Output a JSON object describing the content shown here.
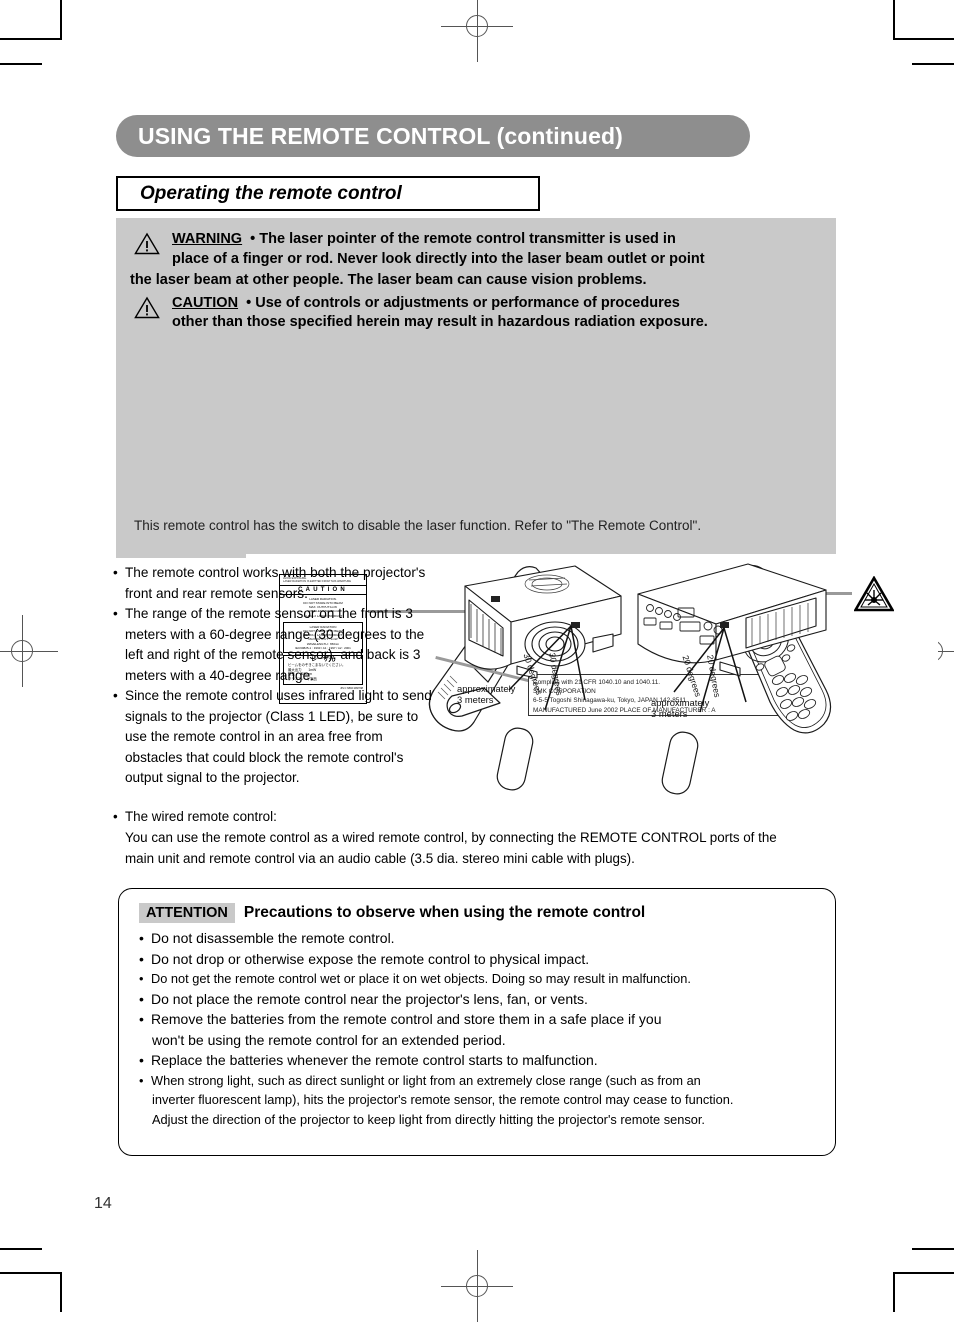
{
  "header": {
    "banner_title": "USING THE REMOTE CONTROL (continued)",
    "subsection_title": "Operating the remote control"
  },
  "warning_panel": {
    "warning_label": "WARNING",
    "warning_text": "• The laser pointer of the remote control transmitter is used in place of a finger or rod. Never look directly into the laser beam outlet or point the laser beam at other people. The laser beam can cause vision problems.",
    "warning_line1": "WARNING",
    "warning_line1_rest": "• The laser pointer of the remote control transmitter is used in",
    "warning_line2": "place of a finger or rod. Never look directly into the laser beam outlet or point",
    "warning_line3": "the laser beam at other people. The laser beam can cause vision problems.",
    "caution_label": "CAUTION",
    "caution_line1_rest": "• Use of controls or adjustments or performance of procedures",
    "caution_line2": "other than those specified herein may result in hazardous radiation exposure.",
    "caution_text": "• Use of controls or adjustments or performance of procedures other than those specified herein may result in hazardous radiation exposure.",
    "illustration_caption": "This remote control has the switch to disable the laser function. Refer to \"The Remote Control\".",
    "laser_label": {
      "top_line1": "AVOID EXPOSURE.",
      "top_line2": "LASER RADIATION IS EMITTED FROM THIS APERTURE",
      "caution_word": "CAUTION",
      "body_line1": "LASER RADIATION.",
      "body_line2": "DO NOT STARE INTO BEAM",
      "body_line3": "MAX. OUTPUT:1mW",
      "body_line4": "WAVELENGTH:650nm",
      "body_line5": "CLASS 2 LASER PRODUCT",
      "box2_line1": "LASER RADIATION",
      "box2_line2": "DO NOT STARE INTO BEAM",
      "box2_line3": "CLASS 2 LASER PRODUCT",
      "box2_line4": "MAX OUTPUT : 1mW",
      "box2_line5": "WAVELENGTH : 650nm",
      "box2_line6": "IEC60825-1 : 1993 / A1 : 1997 / A2 : 2001",
      "jp_title": "レーザ光",
      "jp_line1": "ビームをのぞきこまないでください。",
      "jp_line2": "最大出力　　1mW",
      "jp_line3": "波長　　650nm",
      "jp_line4": "クラス2レーザ製品",
      "code": "JIS C 6802:1997/98"
    },
    "compliance_box": {
      "line1": "Complies with 21 CFR 1040.10 and 1040.11.",
      "line2": "SMK CORPORATION",
      "line3": "6-5-5 Togoshi Shinagawa-ku, Tokyo, JAPAN 142-8511",
      "line4": "MANUFACTURED June 2002   PLACE OF MANUFACTURER : A"
    }
  },
  "body_bullets": [
    "The remote control works with both the projector's front and rear remote sensors.",
    "The range of the remote sensor on the front is 3 meters with a 60-degree range (30 degrees to the left and right of the remote sensor), and back is 3 meters with a 40-degree range.",
    "Since the remote control uses infrared light to send signals to the projector (Class 1 LED), be sure to use the remote control in an area free from obstacles that could block the remote control's output signal to the projector."
  ],
  "wired": {
    "bullet": "The wired remote control:",
    "line1": "You can use the remote control as a wired remote control, by connecting the REMOTE CONTROL ports of the",
    "line2": "main unit and remote control via an audio cable (3.5 dia. stereo mini cable with plugs)."
  },
  "diagram": {
    "front": {
      "distance_line1": "approximately",
      "distance_line2": "3 meters",
      "angle_left": "30 degrees",
      "angle_right": "30 degrees"
    },
    "rear": {
      "distance_line1": "approximately",
      "distance_line2": "3 meters",
      "angle_left": "20 degrees",
      "angle_right": "20 degrees"
    }
  },
  "attention": {
    "tag": "ATTENTION",
    "title": "Precautions to observe when using the remote control",
    "items": [
      {
        "text": "Do not disassemble the remote control.",
        "small": false,
        "cont": []
      },
      {
        "text": "Do not drop or otherwise expose the remote control to physical impact.",
        "small": false,
        "cont": []
      },
      {
        "text": "Do not get the remote control wet or place it on wet objects. Doing so may result in malfunction.",
        "small": true,
        "cont": []
      },
      {
        "text": "Do not place the remote control near the projector's lens, fan, or vents.",
        "small": false,
        "cont": []
      },
      {
        "text": "Remove the batteries from the remote control and store them in a safe place if you",
        "small": false,
        "cont": [
          "won't be using the remote control for an extended period."
        ]
      },
      {
        "text": "Replace the batteries whenever the remote control starts to malfunction.",
        "small": false,
        "cont": []
      },
      {
        "text": "When strong light, such as direct sunlight or light from an extremely close range (such as from an",
        "small": true,
        "cont": [
          "inverter fluorescent lamp), hits the projector's remote sensor, the remote control may cease to function.",
          "Adjust the direction of the projector to keep light from directly hitting the projector's remote sensor."
        ]
      }
    ]
  },
  "footer": {
    "page_number": "14"
  },
  "colors": {
    "banner_bg": "#8e8e8e",
    "panel_bg": "#c9c9c9",
    "text": "#000000"
  }
}
